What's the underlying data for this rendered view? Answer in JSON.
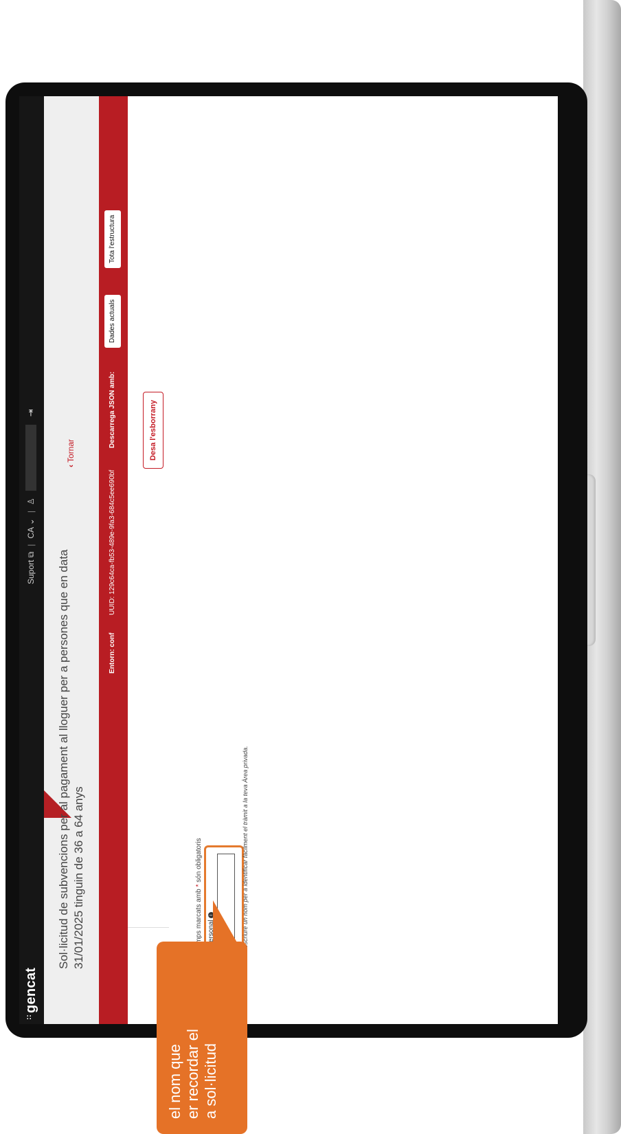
{
  "app": {
    "logo": "gencat",
    "logo_mark": "::"
  },
  "topbar": {
    "support_label": "Suport",
    "support_icon": "external-link-icon",
    "language": "CA",
    "language_chevron": "chevron-down-icon",
    "user_icon": "user-icon",
    "logout_icon": "login-icon"
  },
  "header": {
    "title_line1": "Sol·licitud de subvencions per al pagament al lloguer per a persones que en data",
    "title_line2": "31/01/2025 tinguin de 36 a 64 anys",
    "back_label": "Tornar"
  },
  "redbar": {
    "environment": "Entorn: conf",
    "uuid": "UUID: 129c64ca-fb53-489e-9fa3-684c5ee690bf",
    "download_label": "Descarrega JSON amb:",
    "current_data_button": "Dades actuals",
    "full_structure_button": "Tota l'estructura"
  },
  "form": {
    "save_draft_button": "Desa l'esborrany",
    "required_note_prefix": "Els camps marcats amb",
    "required_star": "*",
    "required_note_suffix": "són obligatoris",
    "field_label": "Codi personal",
    "field_value": "",
    "help_text": "Pots escriure un nom per a identificar fàcilment el tràmit a la teva Àrea privada."
  },
  "callout": {
    "line1": "el nom que",
    "line2": "er recordar el",
    "line3": "a sol·licitud"
  },
  "colors": {
    "brand_red": "#b81d23",
    "callout_orange": "#e57227",
    "topbar_dark": "#161616"
  }
}
